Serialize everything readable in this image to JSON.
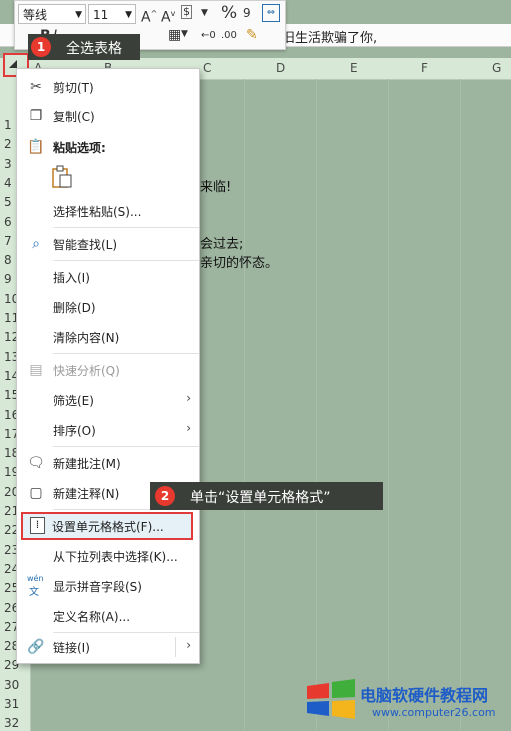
{
  "toolbar": {
    "font_name": "等线",
    "font_size": "11",
    "percent_glyph": "%",
    "bold": "B",
    "italic": "I"
  },
  "formula_bar": {
    "text": "旧生活欺骗了你,"
  },
  "columns": [
    "A",
    "B",
    "C",
    "D",
    "E",
    "F",
    "G"
  ],
  "rows": [
    "1",
    "2",
    "3",
    "4",
    "5",
    "6",
    "7",
    "8",
    "9",
    "10",
    "11",
    "12",
    "13",
    "14",
    "15",
    "16",
    "17",
    "18",
    "19",
    "20",
    "21",
    "22",
    "23",
    "24",
    "25",
    "26",
    "27",
    "28",
    "29",
    "30",
    "31",
    "32"
  ],
  "cells": {
    "c4": "来临!",
    "c7": "会过去;",
    "c8": "亲切的怀态。"
  },
  "callouts": {
    "step1": {
      "number": "1",
      "text": "全选表格"
    },
    "step2": {
      "number": "2",
      "text": "单击“设置单元格格式”"
    }
  },
  "context_menu": {
    "cut": "剪切(T)",
    "copy": "复制(C)",
    "paste_options": "粘贴选项:",
    "paste_special": "选择性粘贴(S)...",
    "smart_lookup": "智能查找(L)",
    "insert": "插入(I)",
    "delete": "删除(D)",
    "clear_contents": "清除内容(N)",
    "quick_analysis": "快速分析(Q)",
    "filter": "筛选(E)",
    "sort": "排序(O)",
    "new_comment": "新建批注(M)",
    "new_note": "新建注释(N)",
    "format_cells": "设置单元格格式(F)...",
    "pick_from_list": "从下拉列表中选择(K)...",
    "show_phonetic": "显示拼音字段(S)",
    "define_name": "定义名称(A)...",
    "link": "链接(I)",
    "phonetic_icon_top": "wén",
    "phonetic_icon_bottom": "文"
  },
  "watermark": {
    "title": "电脑软硬件教程网",
    "url": "www.computer26.com",
    "colors": {
      "red": "#e8392f",
      "green": "#3fae3a",
      "blue": "#1e5cc8",
      "yellow": "#f3b51b"
    }
  }
}
